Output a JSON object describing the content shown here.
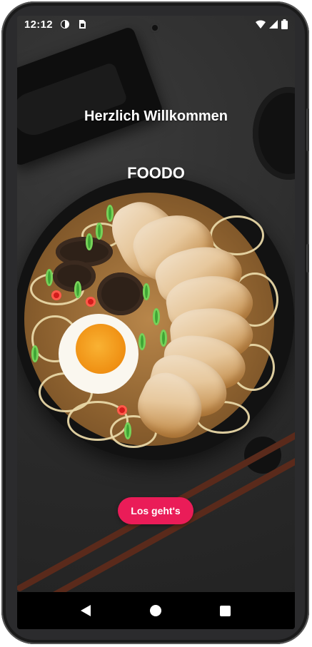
{
  "status_bar": {
    "time": "12:12",
    "left_icons": [
      "theme-icon",
      "sim-card-icon"
    ],
    "right_icons": [
      "wifi-icon",
      "signal-icon",
      "battery-icon"
    ]
  },
  "welcome_text": "Herzlich Willkommen",
  "brand_name": "FOODO",
  "cta_label": "Los geht's",
  "colors": {
    "accent": "#EA1C58",
    "text": "#FFFFFF",
    "navbar": "#000000"
  },
  "navigation": {
    "icons": [
      "back-icon",
      "home-icon",
      "recents-icon"
    ]
  }
}
